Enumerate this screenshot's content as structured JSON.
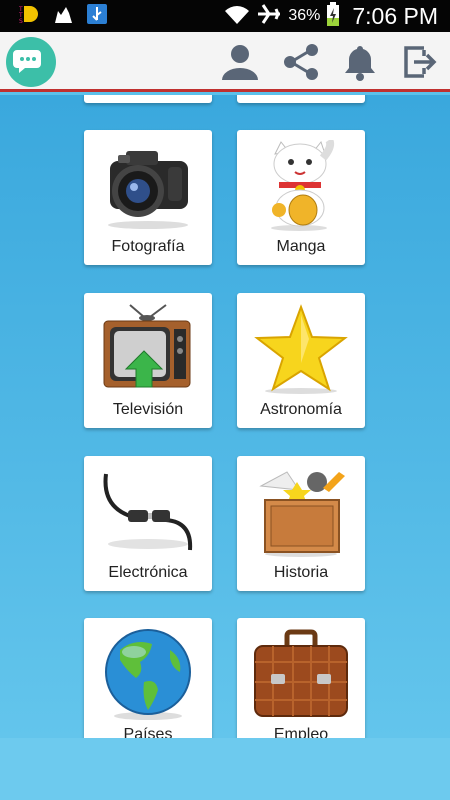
{
  "status_bar": {
    "battery_percent": "36%",
    "time": "7:06 PM",
    "icons": [
      "tts-app-icon",
      "cat-icon",
      "usb-icon",
      "wifi-icon",
      "airplane-icon",
      "battery-charging-icon"
    ]
  },
  "toolbar": {
    "logo_icon": "chat-bubbles-icon",
    "actions": [
      "profile-icon",
      "share-icon",
      "notifications-bell-icon",
      "logout-icon"
    ]
  },
  "categories": [
    {
      "label": "Fotografía",
      "icon": "camera-icon"
    },
    {
      "label": "Manga",
      "icon": "lucky-cat-icon"
    },
    {
      "label": "Televisión",
      "icon": "television-icon"
    },
    {
      "label": "Astronomía",
      "icon": "star-icon"
    },
    {
      "label": "Electrónica",
      "icon": "cable-connector-icon"
    },
    {
      "label": "Historia",
      "icon": "crate-icon"
    },
    {
      "label": "Países",
      "icon": "globe-icon"
    },
    {
      "label": "Empleo",
      "icon": "briefcase-icon"
    }
  ],
  "colors": {
    "status_bar": "#050505",
    "toolbar": "#f4f4f4",
    "toolbar_icons": "#5a6677",
    "accent_line": "#c0302f",
    "logo": "#3cbfa8",
    "background": "#5cc0ea"
  }
}
